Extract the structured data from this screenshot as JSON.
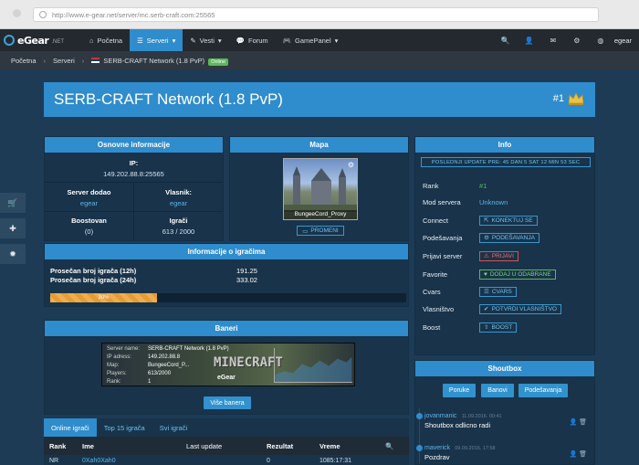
{
  "browser": {
    "url": "http://www.e-gear.net/server/mc.serb-craft.com:25565"
  },
  "nav": {
    "logo": "eGear",
    "logo_suffix": ".NET",
    "items": [
      {
        "label": "Početna",
        "icon": "home-icon"
      },
      {
        "label": "Serveri",
        "icon": "database-icon",
        "active": true
      },
      {
        "label": "Vesti",
        "icon": "pencil-icon"
      },
      {
        "label": "Forum",
        "icon": "comments-icon"
      },
      {
        "label": "GamePanel",
        "icon": "gamepad-icon"
      }
    ],
    "user": "egear"
  },
  "breadcrumb": {
    "home": "Početna",
    "servers": "Serveri",
    "current": "SERB-CRAFT Network (1.8 PvP)",
    "badge": "Online"
  },
  "server": {
    "title": "SERB-CRAFT Network (1.8 PvP)",
    "rank": "#1"
  },
  "basic": {
    "header": "Osnovne informacije",
    "ip_label": "IP:",
    "ip": "149.202.88.8:25565",
    "added_by_label": "Server dodao",
    "added_by": "egear",
    "owner_label": "Vlasnik:",
    "owner": "egear",
    "boost_label": "Boostovan",
    "boost": "(0)",
    "players_label": "Igrači",
    "players": "613 / 2000"
  },
  "map": {
    "header": "Mapa",
    "name": "BungeeCord_Proxy",
    "change": "PROMENI"
  },
  "info": {
    "header": "Info",
    "last_update": "POSLEDNJI UPDATE PRE: 45 DAN 5 SAT 12 MIN 53 SEC",
    "rank_label": "Rank",
    "rank": "#1",
    "mod_label": "Mod servera",
    "mod": "Unknown",
    "connect_label": "Connect",
    "connect_btn": "KONEKTUJ SE",
    "settings_label": "Podešavanja",
    "settings_btn": "PODEŠAVANJA",
    "report_label": "Prijavi server",
    "report_btn": "PRIJAVI",
    "fav_label": "Favorite",
    "fav_btn": "DODAJ U ODABRANE",
    "cvars_label": "Cvars",
    "cvars_btn": "CVARS",
    "owner_label": "Vlasništvo",
    "owner_btn": "POTVRDI VLASNIŠTVO",
    "boost_label": "Boost",
    "boost_btn": "BOOST"
  },
  "players_info": {
    "header": "Informacije o igračima",
    "avg12_label": "Prosečan broj igrača (12h)",
    "avg12": "191.25",
    "avg24_label": "Prosečan broj igrača (24h)",
    "avg24": "333.02",
    "progress": 30,
    "progress_label": "30%"
  },
  "banners": {
    "header": "Baneri",
    "name_label": "Server name:",
    "name": "SERB-CRAFT Network (1.8 PvP)",
    "ip_label": "IP adress:",
    "ip": "149.202.88.8",
    "map_label": "Map:",
    "map": "BungeeCord_P...",
    "players_label": "Players:",
    "players": "613/2000",
    "rank_label": "Rank:",
    "rank": "1",
    "mc": "MINECRAFT",
    "brand": "eGear",
    "more": "Više banera"
  },
  "tabs": [
    "Online igrači",
    "Top 15 igrača",
    "Svi igrači"
  ],
  "table": {
    "headers": [
      "Rank",
      "Ime",
      "Last update",
      "Rezultat",
      "Vreme"
    ],
    "row": [
      "NR",
      "0Xah0Xah0",
      "",
      "0",
      "1085:17:31"
    ]
  },
  "shoutbox": {
    "header": "Shoutbox",
    "buttons": [
      "Poruke",
      "Banovi",
      "Podešavanja"
    ],
    "messages": [
      {
        "author": "jovanmanic",
        "date": "11.09.2016. 00:41",
        "text": "Shoutbox odlicno radi"
      },
      {
        "author": "maverick",
        "date": "09.09.2016. 17:58",
        "text": "Pozdrav"
      }
    ]
  }
}
